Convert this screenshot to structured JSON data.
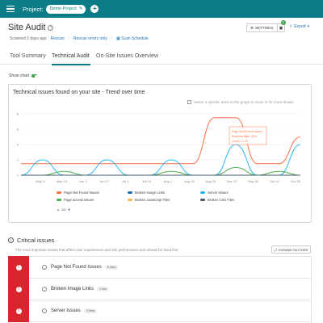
{
  "topbar": {
    "project_label": "Project:",
    "project_name": "Demo Project"
  },
  "header": {
    "title": "Site Audit",
    "scanned": "Scanned 2 days ago",
    "rescan": "Rescan",
    "rescan_errors": "Rescan errors only",
    "scan_schedule": "Scan Schedule",
    "settings": "SETTINGS",
    "notif_count": "0",
    "export": "Export"
  },
  "tabs": [
    "Tool Summary",
    "Technical Audit",
    "On-Site Issues Overview"
  ],
  "show_chart": "Show chart",
  "chart_card": {
    "title": "Technical issues found on your site - Trend over time",
    "zoom_hint": "Select a specific area on the graph to zoom in for more details"
  },
  "chart_data": {
    "type": "line",
    "x": [
      "May 5",
      "May 19",
      "Jun 2",
      "Jun 17",
      "Jul 1",
      "Jul 15",
      "Aug 1",
      "Aug 15",
      "Aug 29",
      "Sep 12",
      "Sep 26",
      "Oct 10",
      "Oct 26"
    ],
    "y_ticks": [
      0,
      2,
      4,
      6,
      8
    ],
    "ylim": [
      0,
      8
    ],
    "series": [
      {
        "name": "Page Not Found Issues",
        "color": "#ff7043",
        "values": [
          1.5,
          1.5,
          1.5,
          1.5,
          1.5,
          1.5,
          1.5,
          1.5,
          1.5,
          7.5,
          7.5,
          1.5,
          1.5,
          5
        ]
      },
      {
        "name": "Broken Image Links",
        "color": "#1e6fb8",
        "values": [
          0,
          0,
          0,
          0,
          0,
          0,
          0,
          0,
          0,
          0,
          0,
          0,
          0,
          0
        ]
      },
      {
        "name": "Server Issues",
        "color": "#29b6f6",
        "values": [
          0,
          2,
          0,
          0,
          2,
          0,
          0,
          2,
          0,
          0,
          4,
          0,
          0,
          4
        ]
      },
      {
        "name": "Page access issues",
        "color": "#4caf50",
        "values": [
          0,
          0,
          0.5,
          0,
          0,
          0,
          0,
          0.5,
          0,
          0,
          1,
          0,
          0.5,
          0
        ]
      },
      {
        "name": "Broken Javascript Files",
        "color": "#ffb74d",
        "values": [
          0,
          0,
          0,
          0,
          0,
          0,
          0,
          0,
          0,
          0,
          0,
          0,
          0,
          0
        ]
      },
      {
        "name": "Broken CSS Files",
        "color": "#455a64",
        "values": [
          0,
          0,
          0,
          0,
          0,
          0,
          0,
          0,
          0,
          0,
          0,
          0,
          0,
          0
        ]
      }
    ],
    "legend_position": "bottom",
    "grid": true,
    "tooltip": {
      "title": "Page Not Found Issues",
      "line1": "Scanned date: 3/24",
      "line2": "Count: 7 o 0"
    }
  },
  "legend_pager": "1/3",
  "critical": {
    "title": "Critical issues",
    "desc": "The most important issues that affect user experiences and site performance and should be fixed first",
    "expand": "EXPAND FACTORS",
    "items": [
      {
        "name": "Page Not Found Issues",
        "badge": "5 links"
      },
      {
        "name": "Broken Image Links",
        "badge": "1 link"
      },
      {
        "name": "Server Issues",
        "badge": "2 links"
      }
    ]
  },
  "colors": {
    "brand": "#0c7d86",
    "critical": "#d7262d",
    "link": "#1a73b8"
  }
}
